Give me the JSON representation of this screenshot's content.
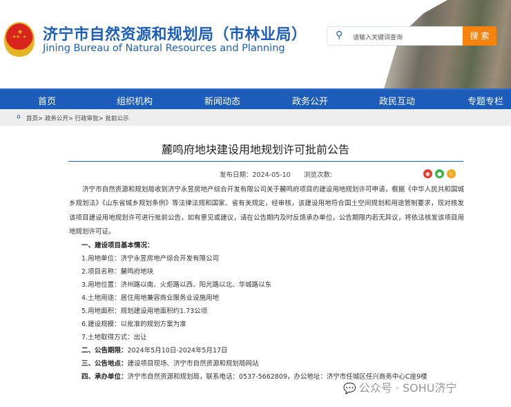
{
  "header": {
    "title_cn": "济宁市自然资源和规划局（市林业局）",
    "title_en": "Jining Bureau of Natural Resources and Planning",
    "search_placeholder": "请输入关键词查询",
    "search_button": "搜 索"
  },
  "nav": [
    "首页",
    "组织机构",
    "新闻动态",
    "政务公开",
    "政民互动",
    "专题专栏"
  ],
  "breadcrumb": "首页> 政务公开> 行政审批> 批前公示",
  "article": {
    "title": "麓鸣府地块建设用地规划许可批前公告",
    "date": "发布日期：2024-05-10",
    "views": "浏览次数:",
    "intro": "济宁市自然资源和规划局收到济宁永昱房地产综合开发有限公司关于麓鸣府项目的建设用地规划许可申请，根据《中华人民共和国城乡规划法》《山东省城乡规划条例》等法律法规和国家、省有关规定，经审核，该建设用地符合国土空间规划和用途管制要求，现对核发该项目建设用地规划许可进行批前公告，如有意见或建议，请在公告期内及时反馈承办单位，公告期限内若无异议，将依法核发该项目用地规划许可证。",
    "section1": "一、建设项目基本情况：",
    "items": [
      "1.用地单位：济宁永昱房地产综合开发有限公司",
      "2.项目名称：麓鸣府地块",
      "3.用地位置：济州路以南、火炬路以西、阳光路以北、华城路以东",
      "4.土地用途：居住用地兼容商业服务业设施用地",
      "5.用地面积：规划建设用地面积约1.73公顷",
      "6.建设规模：以批准的规划方案为准",
      "7.土地取得方式：出让"
    ],
    "section2_label": "二、公告期限：",
    "section2_value": "2024年5月10日-2024年5月17日",
    "section3_label": "三、公告地点：",
    "section3_value": "建设项目现场、济宁市自然资源和规划局网站",
    "section4_label": "四、承办单位：",
    "section4_value": "济宁市自然资源和规划局，联系电话：0537-5662809，办公地址：济宁市任城区任兴商务中心C座9楼"
  },
  "watermark": "公众号 · SOHU济宁"
}
